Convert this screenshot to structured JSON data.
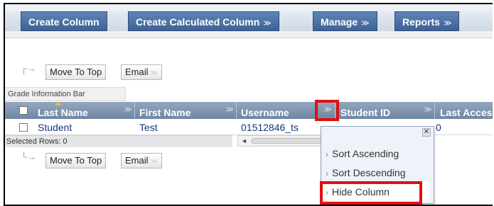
{
  "actionbar": {
    "create_column": "Create Column",
    "create_calculated_column": "Create Calculated Column",
    "manage": "Manage",
    "reports": "Reports",
    "chevron": "≫"
  },
  "toolbar_top": {
    "move_to_top": "Move To Top",
    "email": "Email"
  },
  "toolbar_bottom": {
    "move_to_top": "Move To Top",
    "email": "Email"
  },
  "info_bar": "Grade Information Bar",
  "grid": {
    "columns": [
      "Last Name",
      "First Name",
      "Username",
      "Student ID",
      "Last Acces"
    ],
    "rows": [
      {
        "last_name": "Student",
        "first_name": "Test",
        "username": "01512846_ts"
      }
    ],
    "selected_rows_label": "Selected Rows: 0",
    "edge_digit": "0"
  },
  "context_menu": {
    "items": [
      "Sort Ascending",
      "Sort Descending",
      "Hide Column"
    ],
    "close_glyph": "✕"
  },
  "icons": {
    "column_menu": "double-chevron-down-icon",
    "close": "close-icon",
    "move_arrow": "corner-arrow-icon"
  },
  "colors": {
    "action_button": "#3e6296",
    "grid_header": "#7f95b1",
    "highlight": "#e01010",
    "link": "#14387f"
  }
}
